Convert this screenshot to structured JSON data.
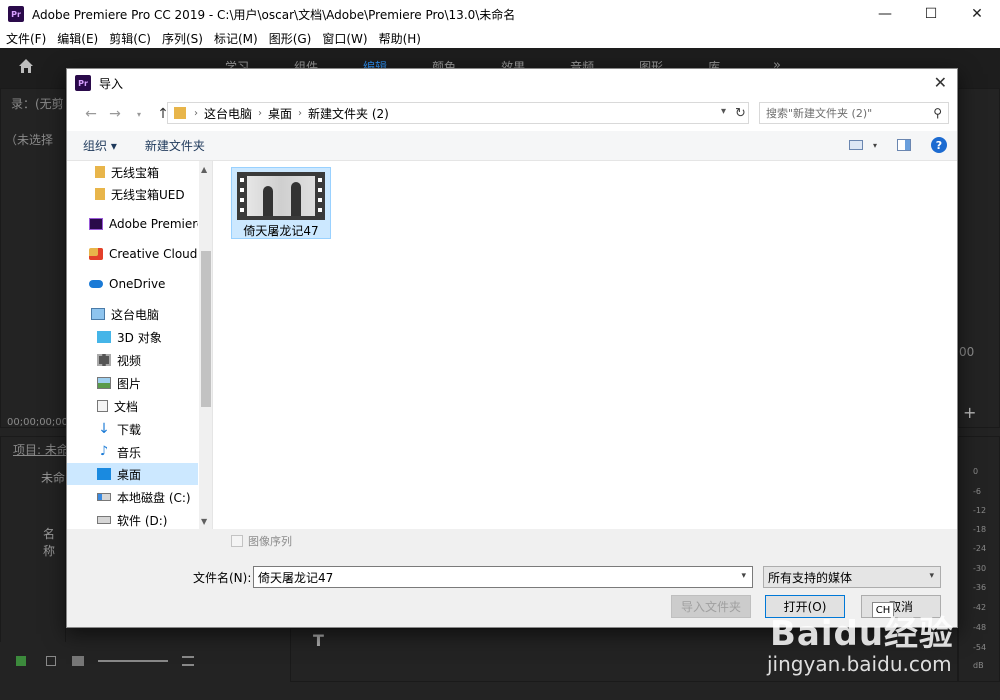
{
  "app": {
    "title": "Adobe Premiere Pro CC 2019 - C:\\用户\\oscar\\文档\\Adobe\\Premiere Pro\\13.0\\未命名",
    "icon_text": "Pr",
    "minimize": "—",
    "maximize": "☐",
    "close": "✕"
  },
  "menu": [
    "文件(F)",
    "编辑(E)",
    "剪辑(C)",
    "序列(S)",
    "标记(M)",
    "图形(G)",
    "窗口(W)",
    "帮助(H)"
  ],
  "workspace_tabs": [
    {
      "label": "学习",
      "active": false
    },
    {
      "label": "组件",
      "active": false
    },
    {
      "label": "编辑",
      "active": true
    },
    {
      "label": "颜色",
      "active": false
    },
    {
      "label": "效果",
      "active": false
    },
    {
      "label": "音频",
      "active": false
    },
    {
      "label": "图形",
      "active": false
    },
    {
      "label": "库",
      "active": false
    }
  ],
  "workspace_more": "»",
  "left_panel": {
    "source_label": "录：(无剪",
    "unselected": "（未选择",
    "timecode": "00;00;00;00",
    "project_tab": "项目: 未命",
    "project_name": "未命",
    "name_col": "名称"
  },
  "right_side": {
    "timecode_frag": "00",
    "plus": "+",
    "meter_scale": [
      "0",
      "-6",
      "-12",
      "-18",
      "-24",
      "-30",
      "-36",
      "-42",
      "-48",
      "-54",
      "dB"
    ]
  },
  "dialog": {
    "title": "导入",
    "close": "✕",
    "nav": {
      "back": "←",
      "forward": "→",
      "up": "↑",
      "refresh": "↻"
    },
    "breadcrumbs": [
      "这台电脑",
      "桌面",
      "新建文件夹 (2)"
    ],
    "search_placeholder": "搜索\"新建文件夹 (2)\"",
    "toolbar": {
      "organize": "组织 ▾",
      "new_folder": "新建文件夹",
      "help": "?"
    },
    "sidebar": [
      {
        "label": "无线宝箱",
        "icon": "folder-icon",
        "selected": false
      },
      {
        "label": "无线宝箱UED",
        "icon": "folder-icon",
        "selected": false
      },
      {
        "label": "Adobe Premiere",
        "icon": "premiere-icon",
        "selected": false
      },
      {
        "label": "Creative Cloud F",
        "icon": "creative-cloud-icon",
        "selected": false
      },
      {
        "label": "OneDrive",
        "icon": "cloud-icon",
        "selected": false
      },
      {
        "label": "这台电脑",
        "icon": "computer-icon",
        "selected": false
      },
      {
        "label": "3D 对象",
        "icon": "cube-icon",
        "selected": false
      },
      {
        "label": "视频",
        "icon": "video-icon",
        "selected": false
      },
      {
        "label": "图片",
        "icon": "picture-icon",
        "selected": false
      },
      {
        "label": "文档",
        "icon": "document-icon",
        "selected": false
      },
      {
        "label": "下载",
        "icon": "download-icon",
        "selected": false
      },
      {
        "label": "音乐",
        "icon": "music-icon",
        "selected": false
      },
      {
        "label": "桌面",
        "icon": "desktop-icon",
        "selected": true
      },
      {
        "label": "本地磁盘 (C:)",
        "icon": "drive-icon",
        "selected": false
      },
      {
        "label": "软件 (D:)",
        "icon": "drive-icon",
        "selected": false
      }
    ],
    "files": [
      {
        "name": "倚天屠龙记47",
        "type": "video"
      }
    ],
    "image_sequence_label": "图像序列",
    "filename_label": "文件名(N):",
    "filename_value": "倚天屠龙记47",
    "file_type": "所有支持的媒体",
    "buttons": {
      "import_folder": "导入文件夹",
      "open": "打开(O)",
      "cancel": "取消"
    }
  },
  "overlay": {
    "ime": "CH",
    "watermark": "Baidu经验",
    "watermark_url": "jingyan.baidu.com"
  },
  "colors": {
    "accent": "#2d8ceb",
    "selection": "#cce8ff",
    "dark_bg": "#232323"
  }
}
